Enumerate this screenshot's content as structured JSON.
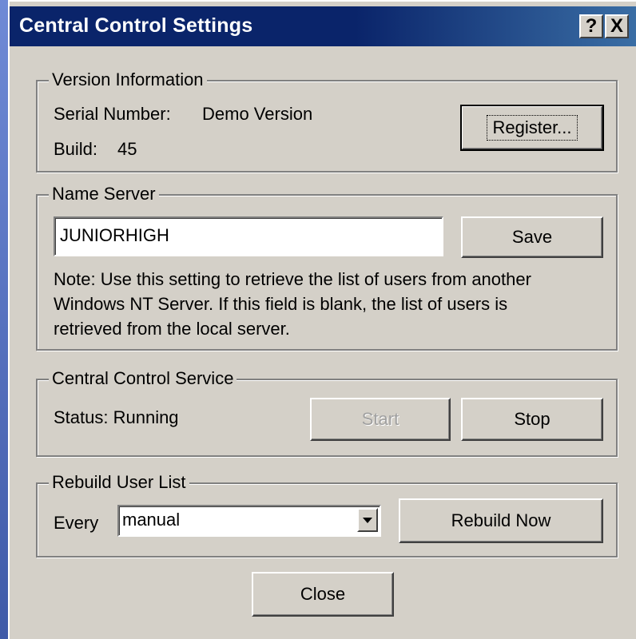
{
  "window": {
    "title": "Central Control Settings",
    "help_glyph": "?",
    "close_glyph": "X"
  },
  "version": {
    "legend": "Version Information",
    "serial_label": "Serial Number:",
    "serial_value": "Demo Version",
    "build_label": "Build:",
    "build_value": "45",
    "register_label": "Register..."
  },
  "name_server": {
    "legend": "Name Server",
    "value": "JUNIORHIGH",
    "save_label": "Save",
    "note_line1": "Note:  Use this setting to retrieve the list of users from another",
    "note_line2": "Windows NT Server.  If this field is blank, the list of users is",
    "note_line3": "retrieved from the local server."
  },
  "service": {
    "legend": "Central Control Service",
    "status_text": "Status: Running",
    "start_label": "Start",
    "stop_label": "Stop"
  },
  "rebuild": {
    "legend": "Rebuild User List",
    "every_label": "Every",
    "selected": "manual",
    "rebuild_label": "Rebuild Now"
  },
  "footer": {
    "close_label": "Close"
  },
  "colors": {
    "title_bar": "#0a246a",
    "dialog_bg": "#d4d0c8",
    "desktop": "#5872c0"
  },
  "icons": {
    "help": "help-icon",
    "close": "close-icon",
    "dropdown": "chevron-down-icon"
  }
}
